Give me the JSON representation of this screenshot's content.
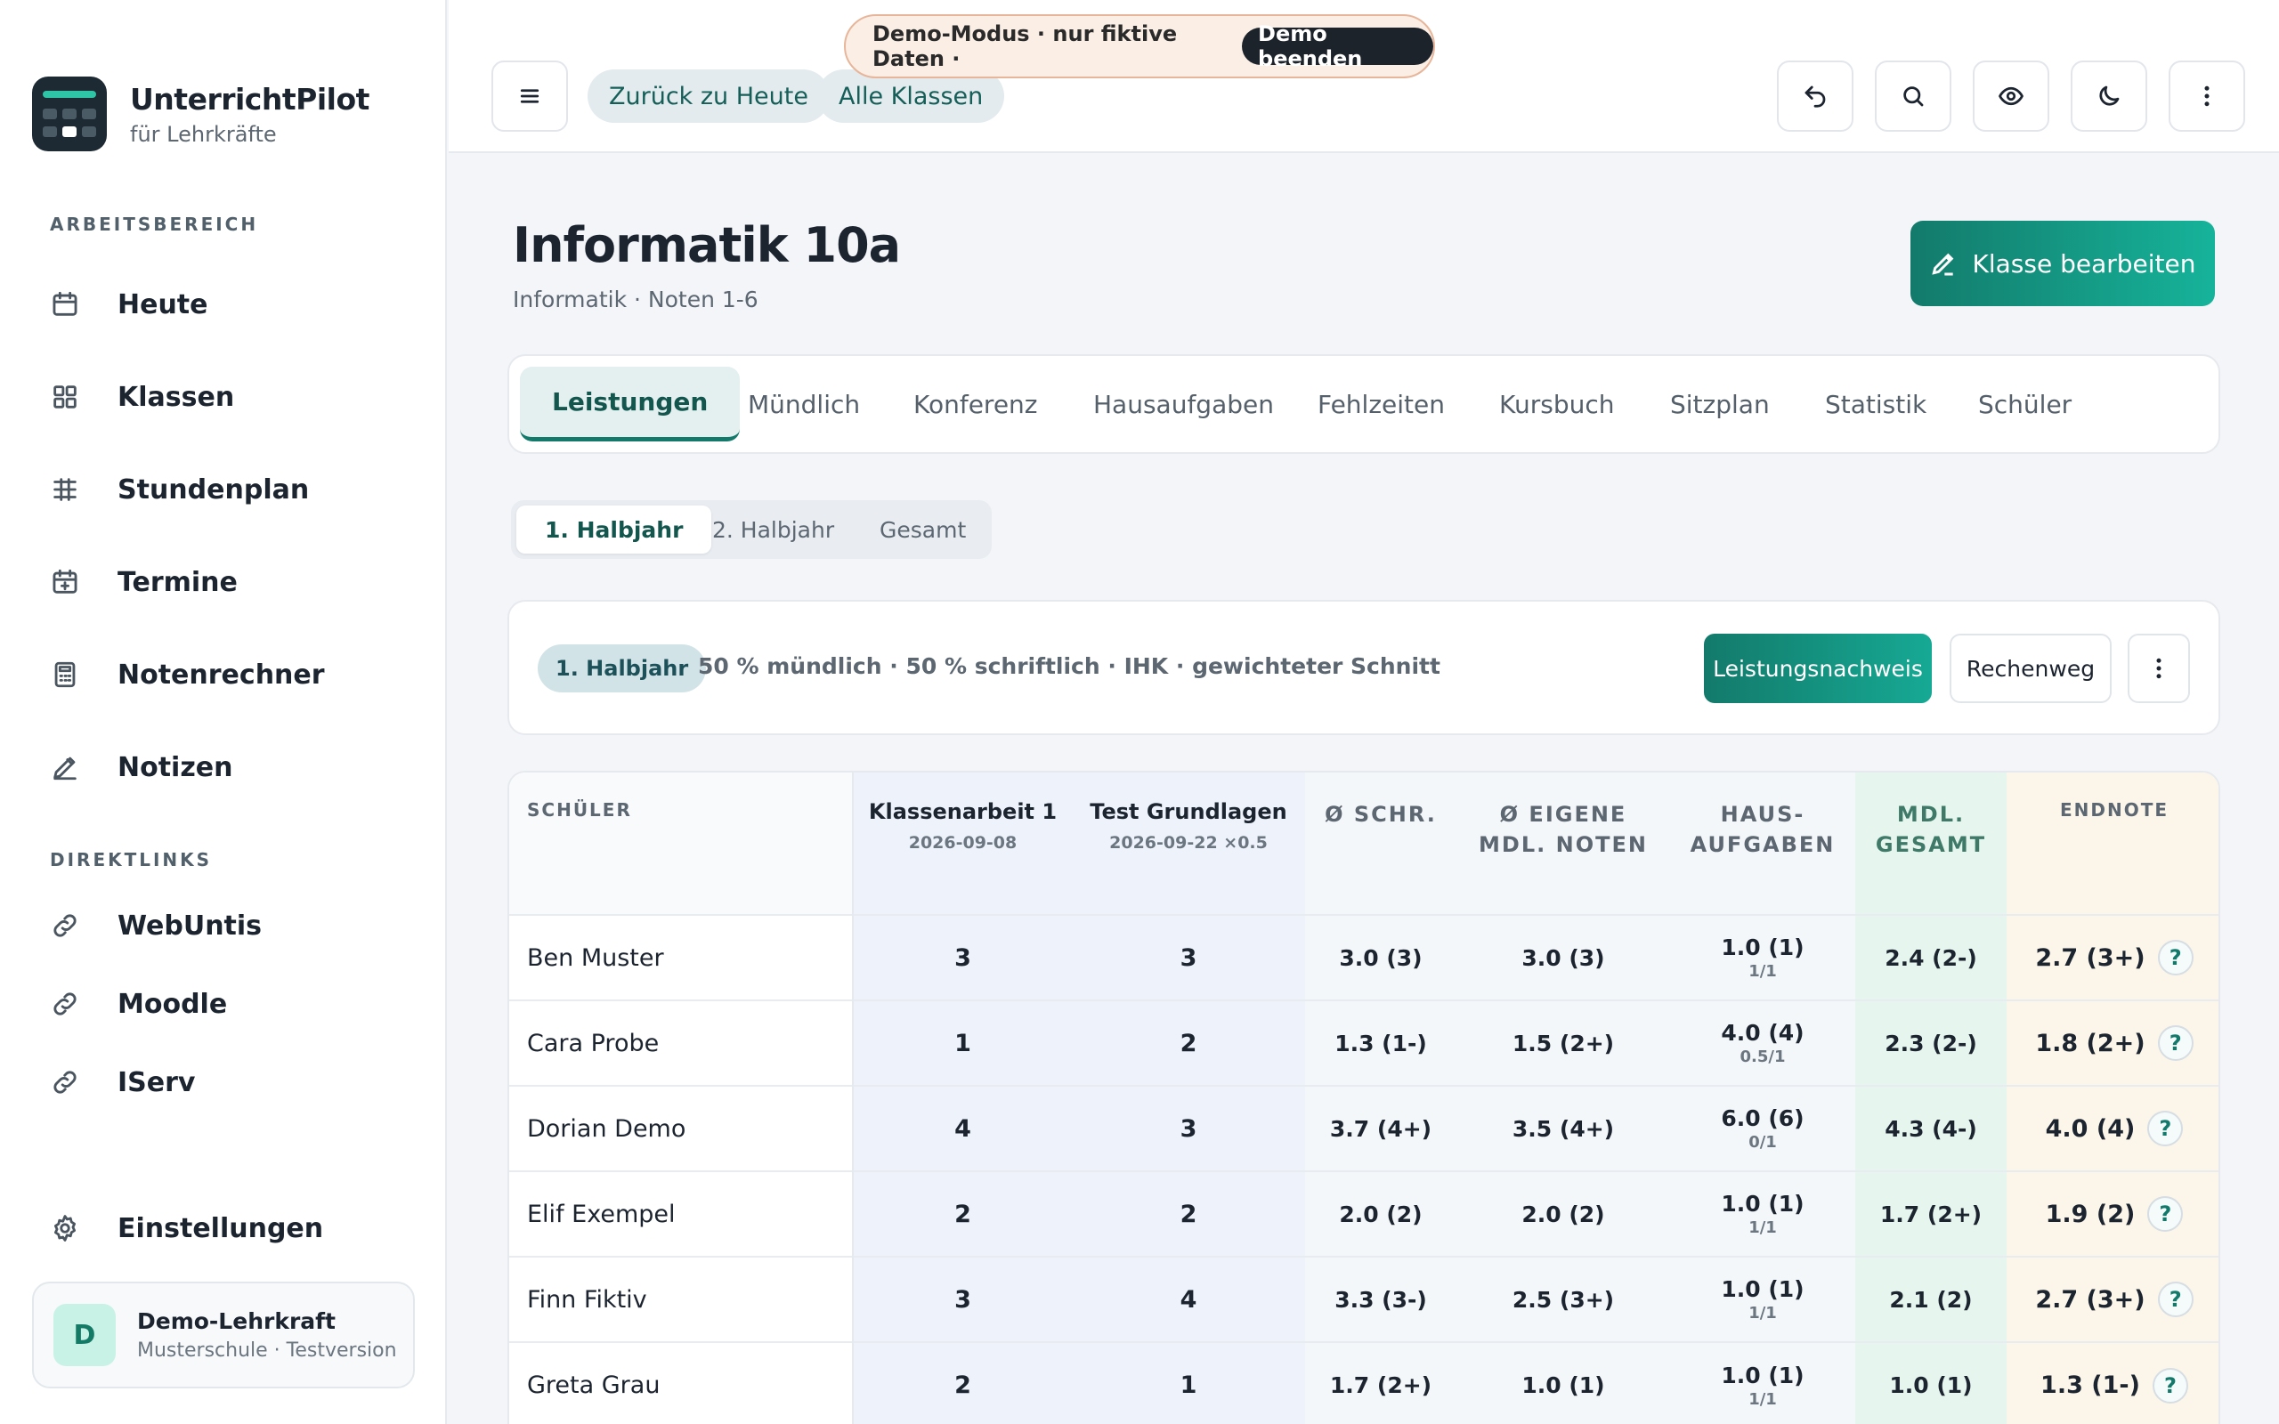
{
  "brand": {
    "name": "UnterrichtPilot",
    "subtitle": "für Lehrkräfte"
  },
  "sidebar": {
    "workspace_label": "ARBEITSBEREICH",
    "items": [
      {
        "label": "Heute",
        "icon": "calendar-icon"
      },
      {
        "label": "Klassen",
        "icon": "grid-icon"
      },
      {
        "label": "Stundenplan",
        "icon": "schedule-icon"
      },
      {
        "label": "Termine",
        "icon": "calendar-plus-icon"
      },
      {
        "label": "Notenrechner",
        "icon": "calculator-icon"
      },
      {
        "label": "Notizen",
        "icon": "pencil-icon"
      }
    ],
    "links_label": "DIREKTLINKS",
    "links": [
      {
        "label": "WebUntis",
        "icon": "link-icon"
      },
      {
        "label": "Moodle",
        "icon": "link-icon"
      },
      {
        "label": "IServ",
        "icon": "link-icon"
      }
    ],
    "settings_label": "Einstellungen",
    "user": {
      "initial": "D",
      "name": "Demo-Lehrkraft",
      "subtitle": "Musterschule · Testversion"
    }
  },
  "header": {
    "back_today": "Zurück zu Heute",
    "all_classes": "Alle Klassen",
    "demo_text": "Demo-Modus · nur fiktive Daten ·",
    "demo_end": "Demo beenden"
  },
  "page": {
    "title": "Informatik 10a",
    "subtitle": "Informatik · Noten 1-6",
    "edit_button": "Klasse bearbeiten"
  },
  "tabs": [
    "Leistungen",
    "Mündlich",
    "Konferenz",
    "Hausaufgaben",
    "Fehlzeiten",
    "Kursbuch",
    "Sitzplan",
    "Statistik",
    "Schüler"
  ],
  "segments": [
    "1. Halbjahr",
    "2. Halbjahr",
    "Gesamt"
  ],
  "info": {
    "badge": "1. Halbjahr",
    "text": "50 % mündlich · 50 % schriftlich · IHK · gewichteter Schnitt",
    "proof_button": "Leistungsnachweis",
    "calc_button": "Rechenweg"
  },
  "table": {
    "headers": {
      "student": "SCHÜLER",
      "exam1_title": "Klassenarbeit 1",
      "exam1_date": "2026-09-08",
      "exam2_title": "Test Grundlagen",
      "exam2_date": "2026-09-22 ×0.5",
      "avg_written": "Ø SCHR.",
      "avg_oral_1": "Ø EIGENE",
      "avg_oral_2": "MDL. NOTEN",
      "homework_1": "HAUS-",
      "homework_2": "AUFGABEN",
      "oral_total_1": "MDL.",
      "oral_total_2": "GESAMT",
      "final": "ENDNOTE"
    },
    "rows": [
      {
        "name": "Ben Muster",
        "exam1": "3",
        "exam2": "3",
        "avg_written": "3.0 (3)",
        "avg_oral": "3.0 (3)",
        "homework": "1.0 (1)",
        "homework_ratio": "1/1",
        "oral_total": "2.4 (2-)",
        "final": "2.7 (3+)"
      },
      {
        "name": "Cara Probe",
        "exam1": "1",
        "exam2": "2",
        "avg_written": "1.3 (1-)",
        "avg_oral": "1.5 (2+)",
        "homework": "4.0 (4)",
        "homework_ratio": "0.5/1",
        "oral_total": "2.3 (2-)",
        "final": "1.8 (2+)"
      },
      {
        "name": "Dorian Demo",
        "exam1": "4",
        "exam2": "3",
        "avg_written": "3.7 (4+)",
        "avg_oral": "3.5 (4+)",
        "homework": "6.0 (6)",
        "homework_ratio": "0/1",
        "oral_total": "4.3 (4-)",
        "final": "4.0 (4)"
      },
      {
        "name": "Elif Exempel",
        "exam1": "2",
        "exam2": "2",
        "avg_written": "2.0 (2)",
        "avg_oral": "2.0 (2)",
        "homework": "1.0 (1)",
        "homework_ratio": "1/1",
        "oral_total": "1.7 (2+)",
        "final": "1.9 (2)"
      },
      {
        "name": "Finn Fiktiv",
        "exam1": "3",
        "exam2": "4",
        "avg_written": "3.3 (3-)",
        "avg_oral": "2.5 (3+)",
        "homework": "1.0 (1)",
        "homework_ratio": "1/1",
        "oral_total": "2.1 (2)",
        "final": "2.7 (3+)"
      },
      {
        "name": "Greta Grau",
        "exam1": "2",
        "exam2": "1",
        "avg_written": "1.7 (2+)",
        "avg_oral": "1.0 (1)",
        "homework": "1.0 (1)",
        "homework_ratio": "1/1",
        "oral_total": "1.0 (1)",
        "final": "1.3 (1-)"
      }
    ],
    "help_glyph": "?"
  },
  "colors": {
    "accent": "#137a6b",
    "accent_light": "#16b39a",
    "demo_border": "#e7b59a"
  }
}
